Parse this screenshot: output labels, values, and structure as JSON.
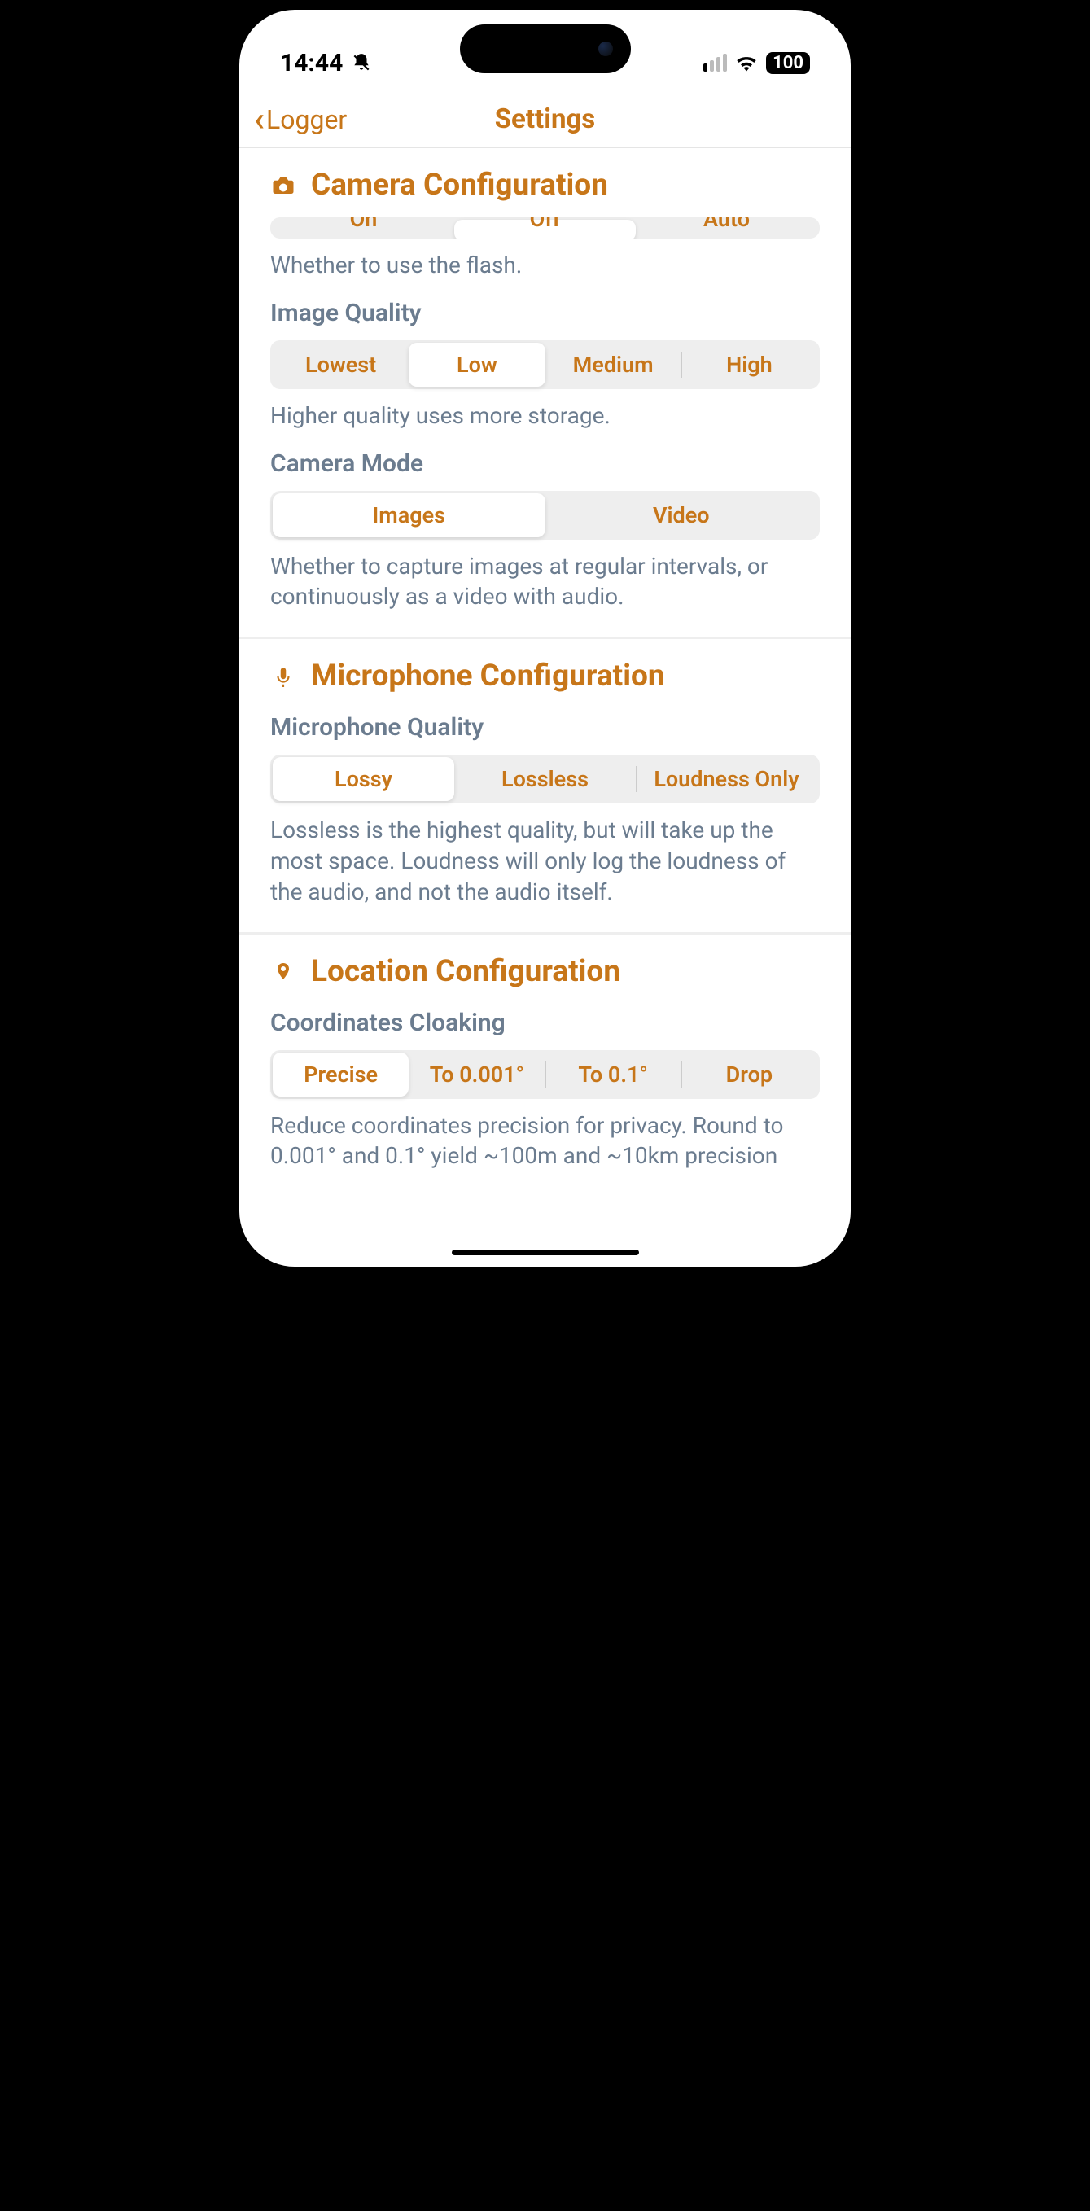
{
  "statusBar": {
    "time": "14:44",
    "battery": "100"
  },
  "nav": {
    "back": "Logger",
    "title": "Settings"
  },
  "camera": {
    "title": "Camera Configuration",
    "flash": {
      "options": [
        "On",
        "Off",
        "Auto"
      ],
      "help": "Whether to use the flash.",
      "selectedIndex": 1
    },
    "imageQuality": {
      "label": "Image Quality",
      "options": [
        "Lowest",
        "Low",
        "Medium",
        "High"
      ],
      "help": "Higher quality uses more storage.",
      "selectedIndex": 1
    },
    "cameraMode": {
      "label": "Camera Mode",
      "options": [
        "Images",
        "Video"
      ],
      "help": "Whether to capture images at regular intervals, or continuously as a video with audio.",
      "selectedIndex": 0
    }
  },
  "microphone": {
    "title": "Microphone Configuration",
    "quality": {
      "label": "Microphone Quality",
      "options": [
        "Lossy",
        "Lossless",
        "Loudness Only"
      ],
      "help": "Lossless is the highest quality, but will take up the most space. Loudness will only log the loudness of the audio, and not the audio itself.",
      "selectedIndex": 0
    }
  },
  "location": {
    "title": "Location Configuration",
    "cloaking": {
      "label": "Coordinates Cloaking",
      "options": [
        "Precise",
        "To 0.001°",
        "To 0.1°",
        "Drop"
      ],
      "help": "Reduce coordinates precision for privacy. Round to 0.001° and 0.1° yield ~100m and ~10km precision",
      "selectedIndex": 0
    }
  }
}
